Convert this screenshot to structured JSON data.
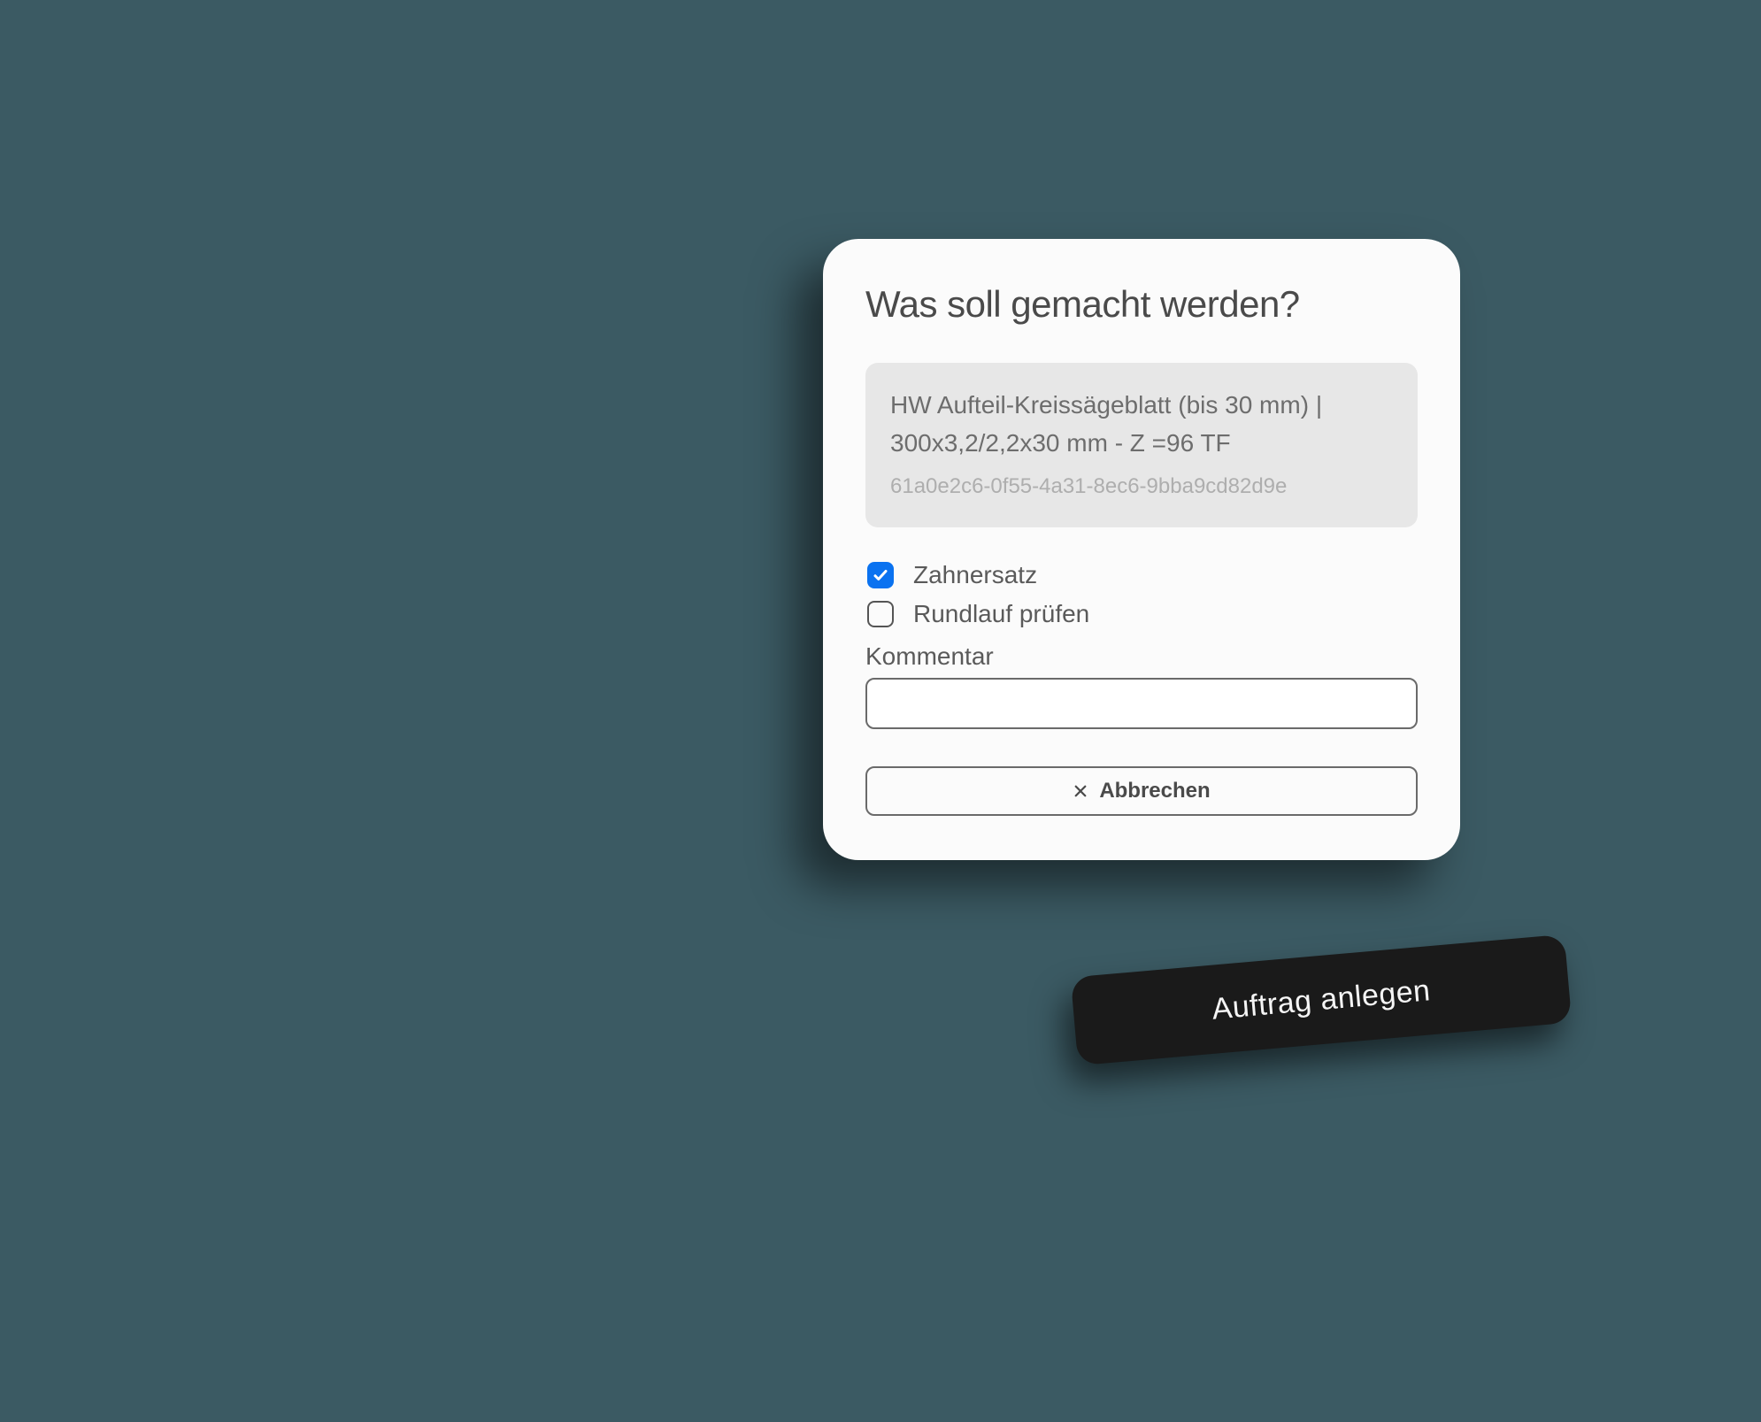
{
  "dialog": {
    "title": "Was soll gemacht werden?",
    "product": {
      "description": "HW Aufteil-Kreissägeblatt (bis 30 mm) | 300x3,2/2,2x30 mm - Z =96 TF",
      "id": "61a0e2c6-0f55-4a31-8ec6-9bba9cd82d9e"
    },
    "options": {
      "opt1_label": "Zahnersatz",
      "opt1_checked": true,
      "opt2_label": "Rundlauf prüfen",
      "opt2_checked": false
    },
    "comment_label": "Kommentar",
    "comment_value": "",
    "cancel_label": "Abbrechen"
  },
  "floating": {
    "create_label": "Auftrag anlegen"
  }
}
